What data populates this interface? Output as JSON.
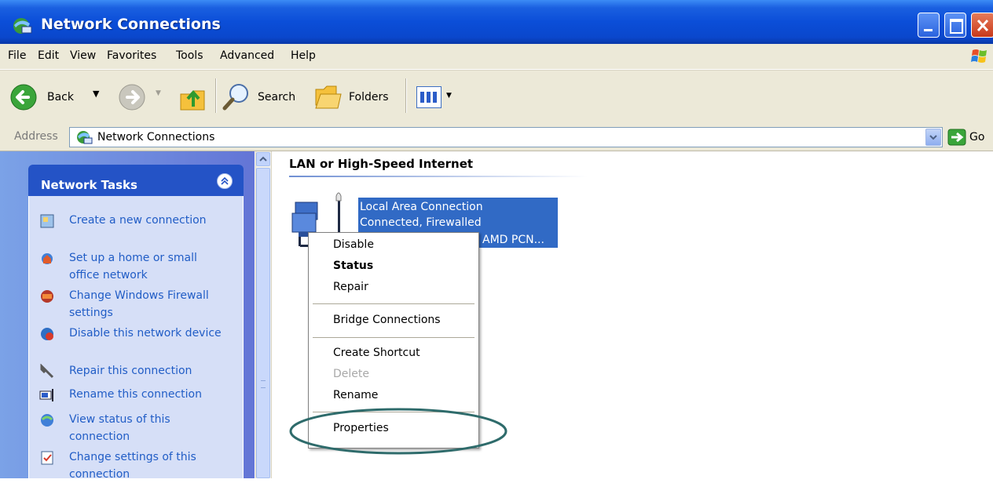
{
  "window": {
    "title": "Network Connections"
  },
  "menu": [
    "File",
    "Edit",
    "View",
    "Favorites",
    "Tools",
    "Advanced",
    "Help"
  ],
  "toolbar": {
    "back_label": "Back",
    "search_label": "Search",
    "folders_label": "Folders"
  },
  "address": {
    "label": "Address",
    "value": "Network Connections",
    "go_label": "Go"
  },
  "tasks": {
    "title": "Network Tasks",
    "items": [
      {
        "label": "Create a new connection",
        "icon": "new-connection-icon"
      },
      {
        "label": "Set up a home or small office network",
        "icon": "home-network-icon"
      },
      {
        "label": "Change Windows Firewall settings",
        "icon": "firewall-icon"
      },
      {
        "label": "Disable this network device",
        "icon": "disable-device-icon"
      },
      {
        "label": "Repair this connection",
        "icon": "repair-icon"
      },
      {
        "label": "Rename this connection",
        "icon": "rename-icon"
      },
      {
        "label": "View status of this connection",
        "icon": "status-icon"
      },
      {
        "label": "Change settings of this connection",
        "icon": "settings-icon"
      }
    ]
  },
  "content": {
    "group_header": "LAN or High-Speed Internet",
    "connection": {
      "name": "Local Area Connection",
      "status": "Connected, Firewalled",
      "device": "AMD PCN..."
    }
  },
  "context_menu": {
    "items": [
      {
        "label": "Disable",
        "bold": false,
        "disabled": false
      },
      {
        "label": "Status",
        "bold": true,
        "disabled": false
      },
      {
        "label": "Repair",
        "bold": false,
        "disabled": false
      },
      {
        "label": "Bridge Connections",
        "bold": false,
        "disabled": false
      },
      {
        "label": "Create Shortcut",
        "bold": false,
        "disabled": false
      },
      {
        "label": "Delete",
        "bold": false,
        "disabled": true
      },
      {
        "label": "Rename",
        "bold": false,
        "disabled": false
      },
      {
        "label": "Properties",
        "bold": false,
        "disabled": false
      }
    ]
  },
  "colors": {
    "titlebar": "#0a47cc",
    "selection": "#316ac5",
    "task_link": "#215dc6",
    "highlight_ellipse": "#2e6b6b"
  }
}
